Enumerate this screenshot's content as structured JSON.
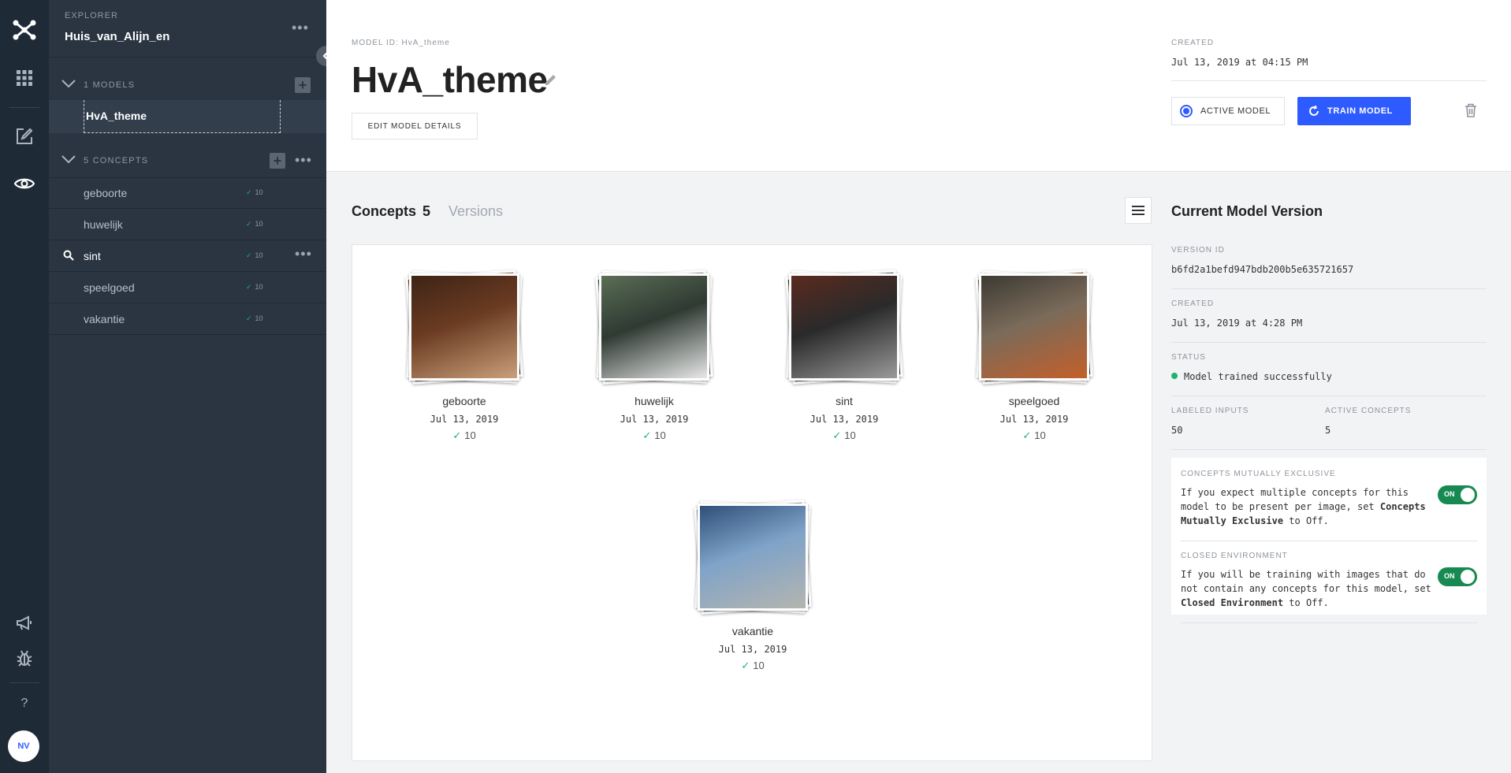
{
  "rail": {
    "avatar": "NV",
    "help": "?",
    "colors": {
      "bg": "#1f2a37",
      "accent": "#2e5bff"
    }
  },
  "explorer": {
    "label": "EXPLORER",
    "app_name": "Huis_van_Alijn_en",
    "models_header": "1 MODELS",
    "models": [
      {
        "name": "HvA_theme"
      }
    ],
    "concepts_header": "5 CONCEPTS",
    "concepts": [
      {
        "name": "geboorte",
        "count": "10"
      },
      {
        "name": "huwelijk",
        "count": "10"
      },
      {
        "name": "sint",
        "count": "10"
      },
      {
        "name": "speelgoed",
        "count": "10"
      },
      {
        "name": "vakantie",
        "count": "10"
      }
    ]
  },
  "header": {
    "model_id_label": "MODEL ID: HvA_theme",
    "title": "HvA_theme",
    "edit_button": "EDIT MODEL DETAILS",
    "created_label": "CREATED",
    "created_value": "Jul 13, 2019 at 04:15 PM",
    "active_model_button": "ACTIVE MODEL",
    "train_model_button": "TRAIN MODEL"
  },
  "tabs": {
    "concepts_label": "Concepts",
    "concepts_count": "5",
    "versions_label": "Versions"
  },
  "concept_cards": [
    {
      "name": "geboorte",
      "date": "Jul 13, 2019",
      "count": "10",
      "colors": [
        "#6b3b22",
        "#c9a07a",
        "#3d2415"
      ]
    },
    {
      "name": "huwelijk",
      "date": "Jul 13, 2019",
      "count": "10",
      "colors": [
        "#2f3a33",
        "#e8e8e8",
        "#5a6d55"
      ]
    },
    {
      "name": "sint",
      "date": "Jul 13, 2019",
      "count": "10",
      "colors": [
        "#2a2a2a",
        "#9a9a9a",
        "#5a2a1f"
      ]
    },
    {
      "name": "speelgoed",
      "date": "Jul 13, 2019",
      "count": "10",
      "colors": [
        "#7a6b5a",
        "#c45f2a",
        "#3c3a33"
      ]
    },
    {
      "name": "vakantie",
      "date": "Jul 13, 2019",
      "count": "10",
      "colors": [
        "#7fa3c8",
        "#b5b5b0",
        "#2e4f7a"
      ]
    }
  ],
  "version": {
    "title": "Current Model Version",
    "version_id_label": "VERSION ID",
    "version_id": "b6fd2a1befd947bdb200b5e635721657",
    "created_label": "CREATED",
    "created_value": "Jul 13, 2019 at 4:28 PM",
    "status_label": "STATUS",
    "status_value": "Model trained successfully",
    "labeled_inputs_label": "LABELED INPUTS",
    "labeled_inputs": "50",
    "active_concepts_label": "ACTIVE CONCEPTS",
    "active_concepts": "5",
    "mutually_exclusive_label": "CONCEPTS MUTUALLY EXCLUSIVE",
    "mutually_exclusive_text_1": "If you expect multiple concepts for this model to be present per image, set ",
    "mutually_exclusive_bold": "Concepts Mutually Exclusive",
    "mutually_exclusive_text_2": " to Off.",
    "mutually_exclusive_toggle": "ON",
    "closed_env_label": "CLOSED ENVIRONMENT",
    "closed_env_text_1": "If you will be training with images that do not contain any concepts for this model, set ",
    "closed_env_bold": "Closed Environment",
    "closed_env_text_2": " to Off.",
    "closed_env_toggle": "ON",
    "status_color": "#1db36b"
  }
}
